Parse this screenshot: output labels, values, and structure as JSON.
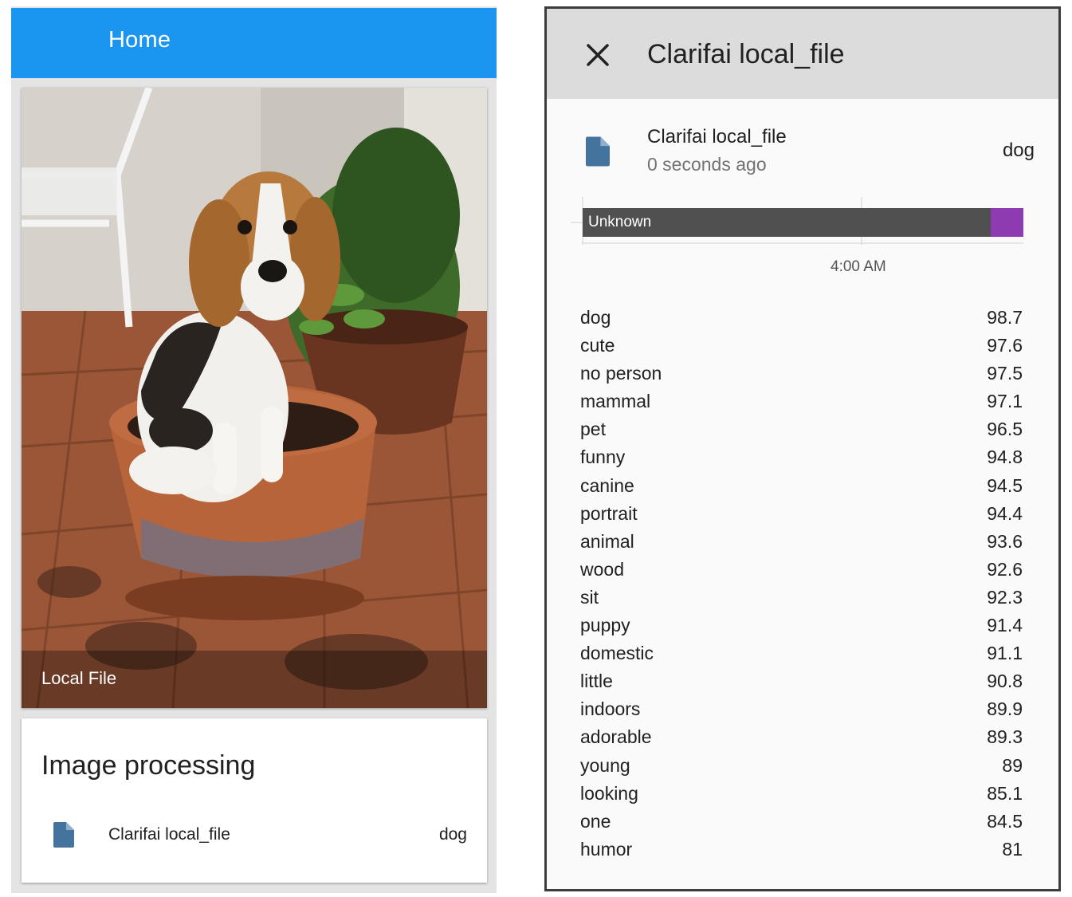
{
  "header": {
    "title": "Home"
  },
  "picture_card": {
    "caption": "Local File"
  },
  "entities_card": {
    "title": "Image processing",
    "entity": {
      "name": "Clarifai local_file",
      "state": "dog",
      "icon": "file-document-icon"
    }
  },
  "more_info_dialog": {
    "close_icon": "close-icon",
    "title": "Clarifai local_file",
    "entity_name": "Clarifai local_file",
    "last_changed": "0 seconds ago",
    "state": "dog",
    "history": {
      "bar_label": "Unknown",
      "tick_label": "4:00 AM",
      "colors": {
        "unknown": "#505050",
        "dog": "#8e3ab0"
      }
    },
    "attributes": [
      {
        "name": "dog",
        "value": "98.7"
      },
      {
        "name": "cute",
        "value": "97.6"
      },
      {
        "name": "no person",
        "value": "97.5"
      },
      {
        "name": "mammal",
        "value": "97.1"
      },
      {
        "name": "pet",
        "value": "96.5"
      },
      {
        "name": "funny",
        "value": "94.8"
      },
      {
        "name": "canine",
        "value": "94.5"
      },
      {
        "name": "portrait",
        "value": "94.4"
      },
      {
        "name": "animal",
        "value": "93.6"
      },
      {
        "name": "wood",
        "value": "92.6"
      },
      {
        "name": "sit",
        "value": "92.3"
      },
      {
        "name": "puppy",
        "value": "91.4"
      },
      {
        "name": "domestic",
        "value": "91.1"
      },
      {
        "name": "little",
        "value": "90.8"
      },
      {
        "name": "indoors",
        "value": "89.9"
      },
      {
        "name": "adorable",
        "value": "89.3"
      },
      {
        "name": "young",
        "value": "89"
      },
      {
        "name": "looking",
        "value": "85.1"
      },
      {
        "name": "one",
        "value": "84.5"
      },
      {
        "name": "humor",
        "value": "81"
      }
    ]
  },
  "colors": {
    "header_blue": "#1a96f0",
    "icon_blue": "#44739e"
  }
}
